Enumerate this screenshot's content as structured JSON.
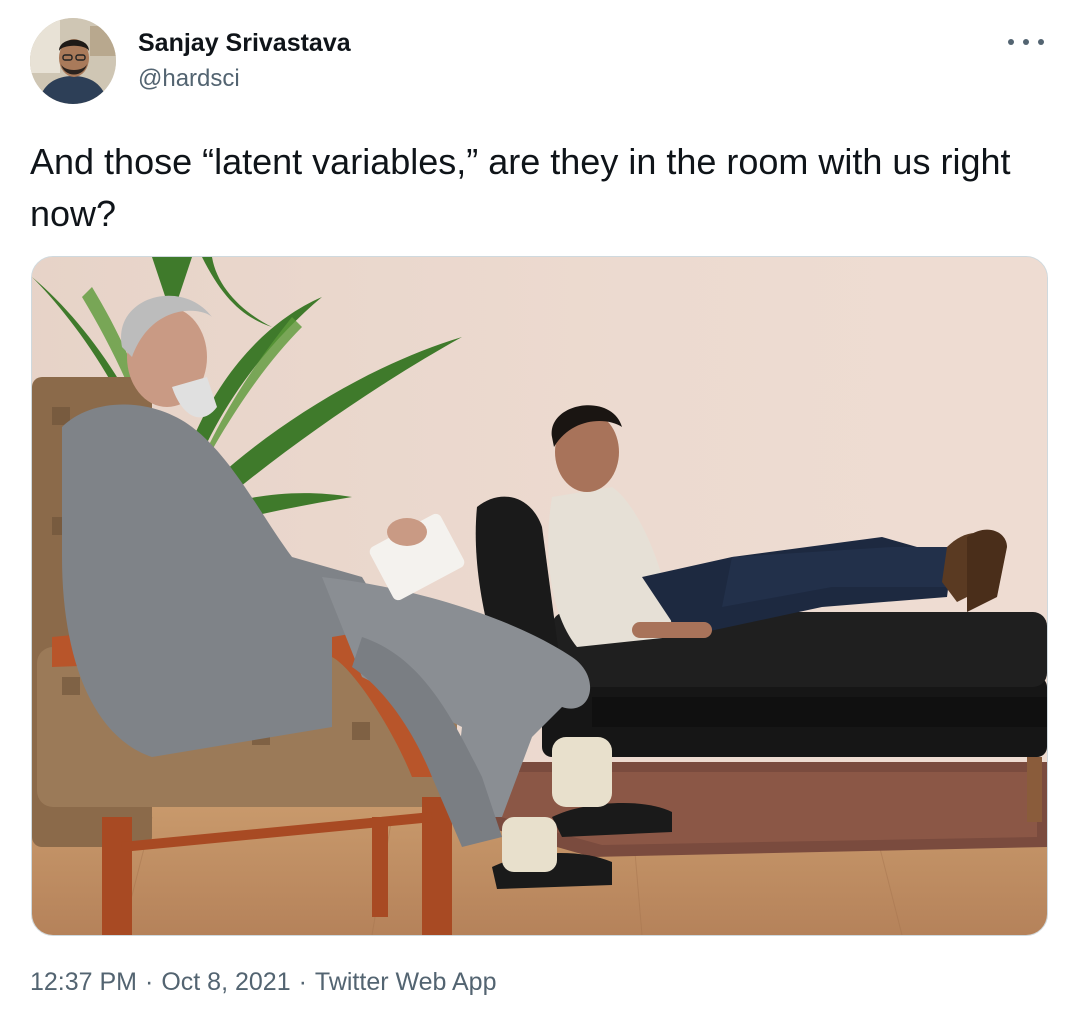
{
  "author": {
    "display_name": "Sanjay Srivastava",
    "handle": "@hardsci",
    "avatar_icon": "profile-photo"
  },
  "menu": {
    "icon": "more-horizontal-icon"
  },
  "tweet": {
    "text": "And those “latent variables,” are they in the room with us right now?"
  },
  "media": {
    "icon": "photo",
    "scene": "therapist-and-patient-on-couch"
  },
  "meta": {
    "time": "12:37 PM",
    "separator": "·",
    "date": "Oct 8, 2021",
    "source": "Twitter Web App"
  },
  "colors": {
    "text_primary": "#0f1419",
    "text_secondary": "#536471",
    "border": "#cfd9de"
  }
}
